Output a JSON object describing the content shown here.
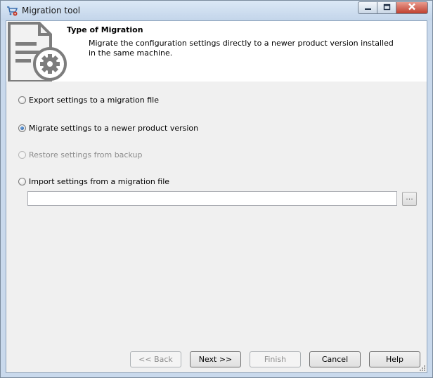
{
  "window": {
    "title": "Migration tool",
    "icon": "cart-gear-icon",
    "controls": [
      "minimize-icon",
      "maximize-icon",
      "close-icon"
    ]
  },
  "header": {
    "title": "Type of Migration",
    "description": "Migrate the configuration settings directly to a newer product version installed in the same machine.",
    "icon": "document-gear-icon"
  },
  "options": [
    {
      "label": "Export settings to a migration file",
      "checked": false,
      "enabled": true
    },
    {
      "label": "Migrate settings to a newer product version",
      "checked": true,
      "enabled": true
    },
    {
      "label": "Restore settings from backup",
      "checked": false,
      "enabled": false
    },
    {
      "label": "Import settings from a migration file",
      "checked": false,
      "enabled": true
    }
  ],
  "import_path": {
    "value": "",
    "browse_label": "..."
  },
  "buttons": {
    "back": "<< Back",
    "next": "Next >>",
    "finish": "Finish",
    "cancel": "Cancel",
    "help": "Help"
  },
  "colors": {
    "accent": "#1d4f91",
    "titlebar": "#c9d9ec",
    "close": "#c0402f"
  }
}
